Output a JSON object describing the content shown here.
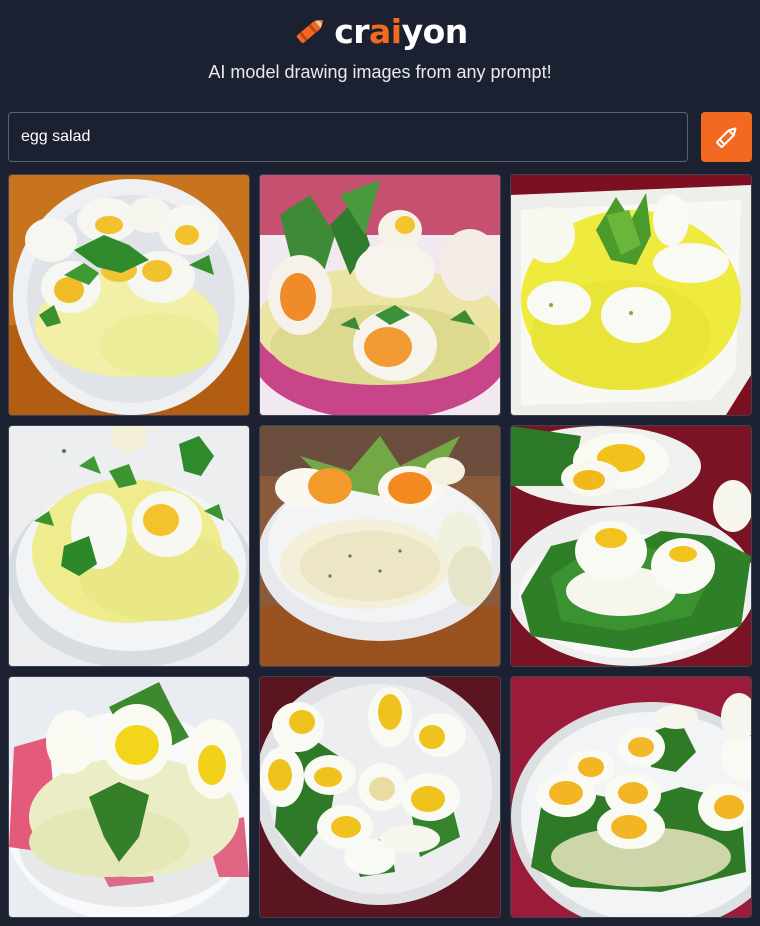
{
  "app": {
    "logo_parts": [
      "cr",
      "ai",
      "yon"
    ],
    "tagline": "AI model drawing images from any prompt!",
    "brand_color": "#f26a21",
    "background_color": "#1b2130",
    "logo_icon": "crayon-icon"
  },
  "search": {
    "value": "egg salad",
    "placeholder": "",
    "button_icon": "pencil-draw-icon"
  },
  "images": [
    {
      "name": "generated-image-1",
      "subject": "egg salad",
      "icon": "egg-salad-image"
    },
    {
      "name": "generated-image-2",
      "subject": "egg salad",
      "icon": "egg-salad-image"
    },
    {
      "name": "generated-image-3",
      "subject": "egg salad",
      "icon": "egg-salad-image"
    },
    {
      "name": "generated-image-4",
      "subject": "egg salad",
      "icon": "egg-salad-image"
    },
    {
      "name": "generated-image-5",
      "subject": "egg salad",
      "icon": "egg-salad-image"
    },
    {
      "name": "generated-image-6",
      "subject": "egg salad",
      "icon": "egg-salad-image"
    },
    {
      "name": "generated-image-7",
      "subject": "egg salad",
      "icon": "egg-salad-image"
    },
    {
      "name": "generated-image-8",
      "subject": "egg salad",
      "icon": "egg-salad-image"
    },
    {
      "name": "generated-image-9",
      "subject": "egg salad",
      "icon": "egg-salad-image"
    }
  ]
}
